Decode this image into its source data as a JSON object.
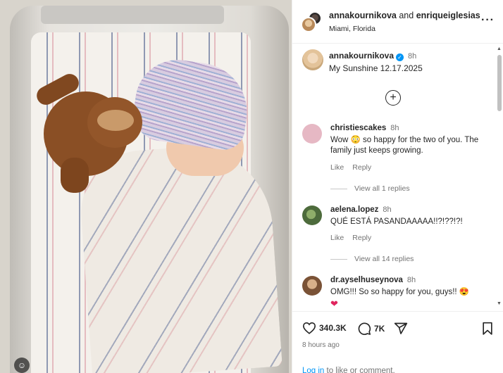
{
  "header": {
    "user1": "annakournikova",
    "joiner": "and",
    "user2": "enriqueiglesias",
    "location": "Miami, Florida",
    "more_icon": "more-horizontal-icon"
  },
  "caption": {
    "username": "annakournikova",
    "time": "8h",
    "text": "My Sunshine 12.17.2025"
  },
  "comments": [
    {
      "username": "christiescakes",
      "time": "8h",
      "text": "Wow 😳 so happy for the two of you. The family just keeps growing.",
      "like": "Like",
      "reply": "Reply",
      "view_replies": "View all 1 replies",
      "avatar_color": "#e6b8c4"
    },
    {
      "username": "aelena.lopez",
      "time": "8h",
      "text": "QUÉ ESTÁ PASANDAAAAA!!?!??!?!",
      "like": "Like",
      "reply": "Reply",
      "view_replies": "View all 14 replies",
      "avatar_color": "#5a7a4a"
    },
    {
      "username": "dr.ayselhuseynova",
      "time": "8h",
      "text": "OMG!!! So so happy for you, guys!! 😍",
      "heart": "❤",
      "avatar_color": "#b58a5a"
    }
  ],
  "actions": {
    "likes": "340.3K",
    "comments": "7K",
    "posted": "8 hours ago",
    "login_link": "Log in",
    "login_rest": " to like or comment."
  },
  "colors": {
    "link": "#0095f6",
    "verified": "#0095f6",
    "secondary_text": "#737373"
  }
}
